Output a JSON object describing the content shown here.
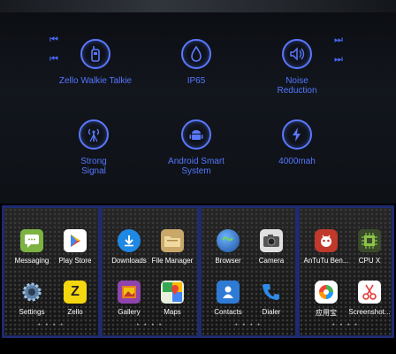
{
  "features": [
    {
      "label": "Zello Walkie Talkie",
      "icon": "walkie-talkie-icon"
    },
    {
      "label": "IP65",
      "icon": "water-drop-icon"
    },
    {
      "label": "Noise\nReduction",
      "icon": "speaker-icon"
    },
    {
      "label": "Strong\nSignal",
      "icon": "antenna-icon"
    },
    {
      "label": "Android Smart\nSystem",
      "icon": "android-icon"
    },
    {
      "label": "4000mah",
      "icon": "lightning-icon"
    }
  ],
  "nav": {
    "prev": "⏮",
    "next": "⏭"
  },
  "screens": [
    {
      "apps": [
        {
          "label": "Messaging",
          "icon": "messaging-icon"
        },
        {
          "label": "Play Store",
          "icon": "play-store-icon"
        },
        {
          "label": "Settings",
          "icon": "settings-icon"
        },
        {
          "label": "Zello",
          "icon": "zello-icon"
        }
      ]
    },
    {
      "apps": [
        {
          "label": "Downloads",
          "icon": "downloads-icon"
        },
        {
          "label": "File Manager",
          "icon": "file-manager-icon"
        },
        {
          "label": "Gallery",
          "icon": "gallery-icon"
        },
        {
          "label": "Maps",
          "icon": "maps-icon"
        }
      ]
    },
    {
      "apps": [
        {
          "label": "Browser",
          "icon": "browser-icon"
        },
        {
          "label": "Camera",
          "icon": "camera-icon"
        },
        {
          "label": "Contacts",
          "icon": "contacts-icon"
        },
        {
          "label": "Dialer",
          "icon": "dialer-icon"
        }
      ]
    },
    {
      "apps": [
        {
          "label": "AnTuTu Ben...",
          "icon": "antutu-icon"
        },
        {
          "label": "CPU X",
          "icon": "cpu-x-icon"
        },
        {
          "label": "应用宝",
          "icon": "app-store-cn-icon"
        },
        {
          "label": "Screenshot...",
          "icon": "screenshot-icon"
        }
      ]
    }
  ],
  "colors": {
    "accent": "#5577ff",
    "background": "#0e1116"
  }
}
